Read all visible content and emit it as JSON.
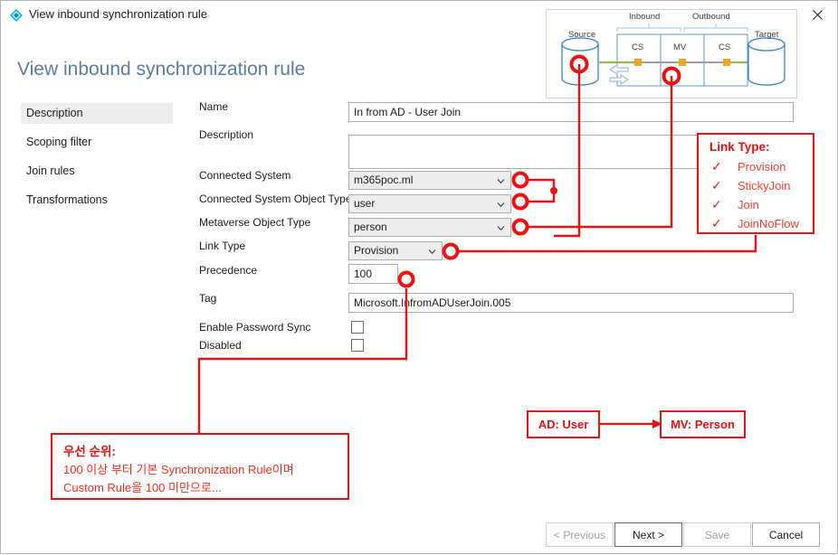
{
  "window": {
    "title": "View inbound synchronization rule",
    "title_icon": "sync-rule-diamond-icon",
    "close_icon": "close-icon",
    "heading": "View inbound synchronization rule"
  },
  "sidebar": {
    "items": [
      {
        "label": "Description",
        "selected": true
      },
      {
        "label": "Scoping filter",
        "selected": false
      },
      {
        "label": "Join rules",
        "selected": false
      },
      {
        "label": "Transformations",
        "selected": false
      }
    ]
  },
  "form": {
    "name": {
      "label": "Name",
      "value": "In from AD - User Join"
    },
    "description": {
      "label": "Description",
      "value": ""
    },
    "connected_system": {
      "label": "Connected System",
      "value": "m365poc.ml",
      "chevron_icon": "chevron-down-icon"
    },
    "connected_system_object_type": {
      "label": "Connected System Object Type",
      "value": "user",
      "chevron_icon": "chevron-down-icon"
    },
    "metaverse_object_type": {
      "label": "Metaverse Object Type",
      "value": "person",
      "chevron_icon": "chevron-down-icon"
    },
    "link_type": {
      "label": "Link Type",
      "value": "Provision",
      "chevron_icon": "chevron-down-icon"
    },
    "precedence": {
      "label": "Precedence",
      "value": "100"
    },
    "tag": {
      "label": "Tag",
      "value": "Microsoft.InfromADUserJoin.005"
    },
    "enable_password_sync": {
      "label": "Enable Password Sync",
      "checked": false
    },
    "disabled": {
      "label": "Disabled",
      "checked": false
    }
  },
  "buttons": {
    "previous": {
      "label": "< Previous",
      "state": "disabled"
    },
    "next": {
      "label": "Next >",
      "state": "default"
    },
    "save": {
      "label": "Save",
      "state": "disabled"
    },
    "cancel": {
      "label": "Cancel",
      "state": "enabled"
    }
  },
  "diagram": {
    "source_label": "Source",
    "target_label": "Target",
    "inbound_label": "Inbound",
    "outbound_label": "Outbound",
    "box_labels": [
      "CS",
      "MV",
      "CS"
    ],
    "source_icon": "database-cylinder-icon",
    "target_icon": "database-cylinder-icon",
    "sync_arrows_icon": "sync-arrows-icon"
  },
  "annotations": {
    "link_type_box": {
      "title": "Link Type:",
      "check_icon": "check-icon",
      "options": [
        "Provision",
        "StickyJoin",
        "Join",
        "JoinNoFlow"
      ]
    },
    "precedence_note": {
      "title": "우선 순위:",
      "line1": "100 이상 부터 기본 Synchronization Rule이며",
      "line2": "Custom Rule을 100 미만으로..."
    },
    "mapping": {
      "source_box": "AD: User",
      "arrow_icon": "arrow-right-icon",
      "target_box": "MV: Person"
    }
  },
  "colors": {
    "annotation_red": "#ee1111",
    "heading_blue": "#5a7ca6",
    "diagram_blue": "#4f90c8",
    "diagram_green": "#8ec04b",
    "diagram_orange": "#f3a81a",
    "title_icon_cyan": "#00b0f0"
  }
}
